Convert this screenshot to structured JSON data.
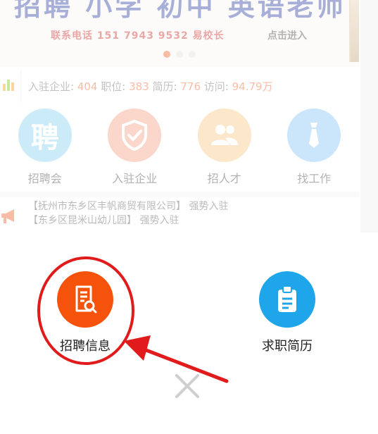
{
  "banner": {
    "title": "招聘 小学 初中 英语老师",
    "contact": "联系电话 151 7943 9532 易校长",
    "enter": "点击进入",
    "carousel_index": 1,
    "carousel_count": 3
  },
  "stats": {
    "companies_label": "入驻企业:",
    "companies": "404",
    "jobs_label": "职位:",
    "jobs": "383",
    "resumes_label": "简历:",
    "resumes": "776",
    "visits_label": "访问:",
    "visits": "94.79万"
  },
  "quick_nav": {
    "items": [
      {
        "label": "招聘会",
        "icon": "pin-character-icon",
        "color": "#8fd3ef",
        "glyph": "聘"
      },
      {
        "label": "入驻企业",
        "icon": "shield-check-icon",
        "color": "#f7a58a"
      },
      {
        "label": "招人才",
        "icon": "people-icon",
        "color": "#f9c98a"
      },
      {
        "label": "找工作",
        "icon": "tie-icon",
        "color": "#8cc7f5"
      }
    ]
  },
  "notice": {
    "icon": "megaphone-icon",
    "lines": [
      "【抚州市东乡区丰帆商贸有限公司】 强势入驻",
      "【东乡区昆米山幼儿园】 强势入驻"
    ]
  },
  "sheet": {
    "post_job": {
      "label": "招聘信息",
      "icon": "document-search-icon",
      "color": "#f5520c"
    },
    "resume": {
      "label": "求职简历",
      "icon": "clipboard-icon",
      "color": "#1ea5ea"
    },
    "close_icon": "close-icon"
  },
  "annotation": {
    "color": "#e11b1b"
  }
}
